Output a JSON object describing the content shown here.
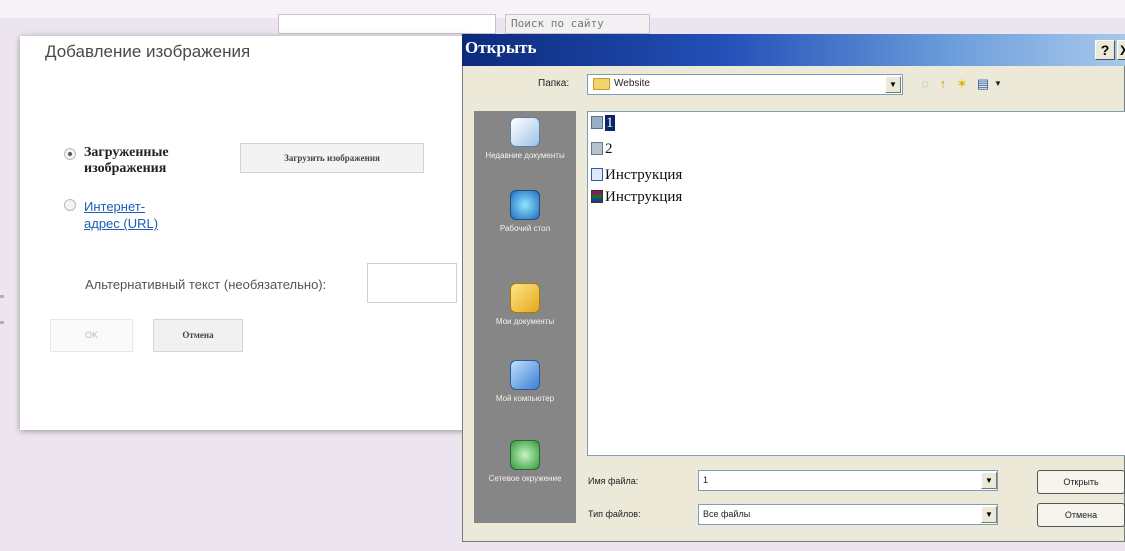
{
  "background": {
    "search_placeholder": "Поиск по сайту"
  },
  "image_dialog": {
    "title": "Добавление изображения",
    "options": [
      {
        "label": "Загруженные изображения",
        "selected": true
      },
      {
        "label": "Интернет-адрес (URL)",
        "selected": false
      }
    ],
    "upload_button": "Загрузить изображения",
    "alt_text_label": "Альтернативный текст (необязательно):",
    "alt_text_value": "",
    "ok_button": "OK",
    "cancel_button": "Отмена"
  },
  "open_dialog": {
    "title": "Открыть",
    "help_button": "?",
    "close_button": "X",
    "folder_label": "Папка:",
    "folder_value": "Website",
    "places": [
      {
        "label": "Недавние документы",
        "icon": "recent-documents-icon"
      },
      {
        "label": "Рабочий стол",
        "icon": "desktop-icon"
      },
      {
        "label": "Мои документы",
        "icon": "my-documents-icon"
      },
      {
        "label": "Мой компьютер",
        "icon": "my-computer-icon"
      },
      {
        "label": "Сетевое окружение",
        "icon": "network-places-icon"
      }
    ],
    "files": [
      {
        "name": "1",
        "icon": "image-file-icon",
        "selected": true
      },
      {
        "name": "2",
        "icon": "image-file-icon",
        "selected": false
      },
      {
        "name": "Инструкция",
        "icon": "word-document-icon",
        "selected": false
      },
      {
        "name": "Инструкция",
        "icon": "winrar-archive-icon",
        "selected": false
      }
    ],
    "filename_label": "Имя файла:",
    "filename_value": "1",
    "filetype_label": "Тип файлов:",
    "filetype_value": "Все файлы",
    "open_button": "Открыть",
    "cancel_button": "Отмена"
  },
  "colors": {
    "title_bar_start": "#0b2a7c",
    "title_bar_end": "#a8c8ec",
    "places_bar": "#868686",
    "selection": "#0a246a",
    "link": "#1a5fb4",
    "page_background": "#ece4ee"
  }
}
